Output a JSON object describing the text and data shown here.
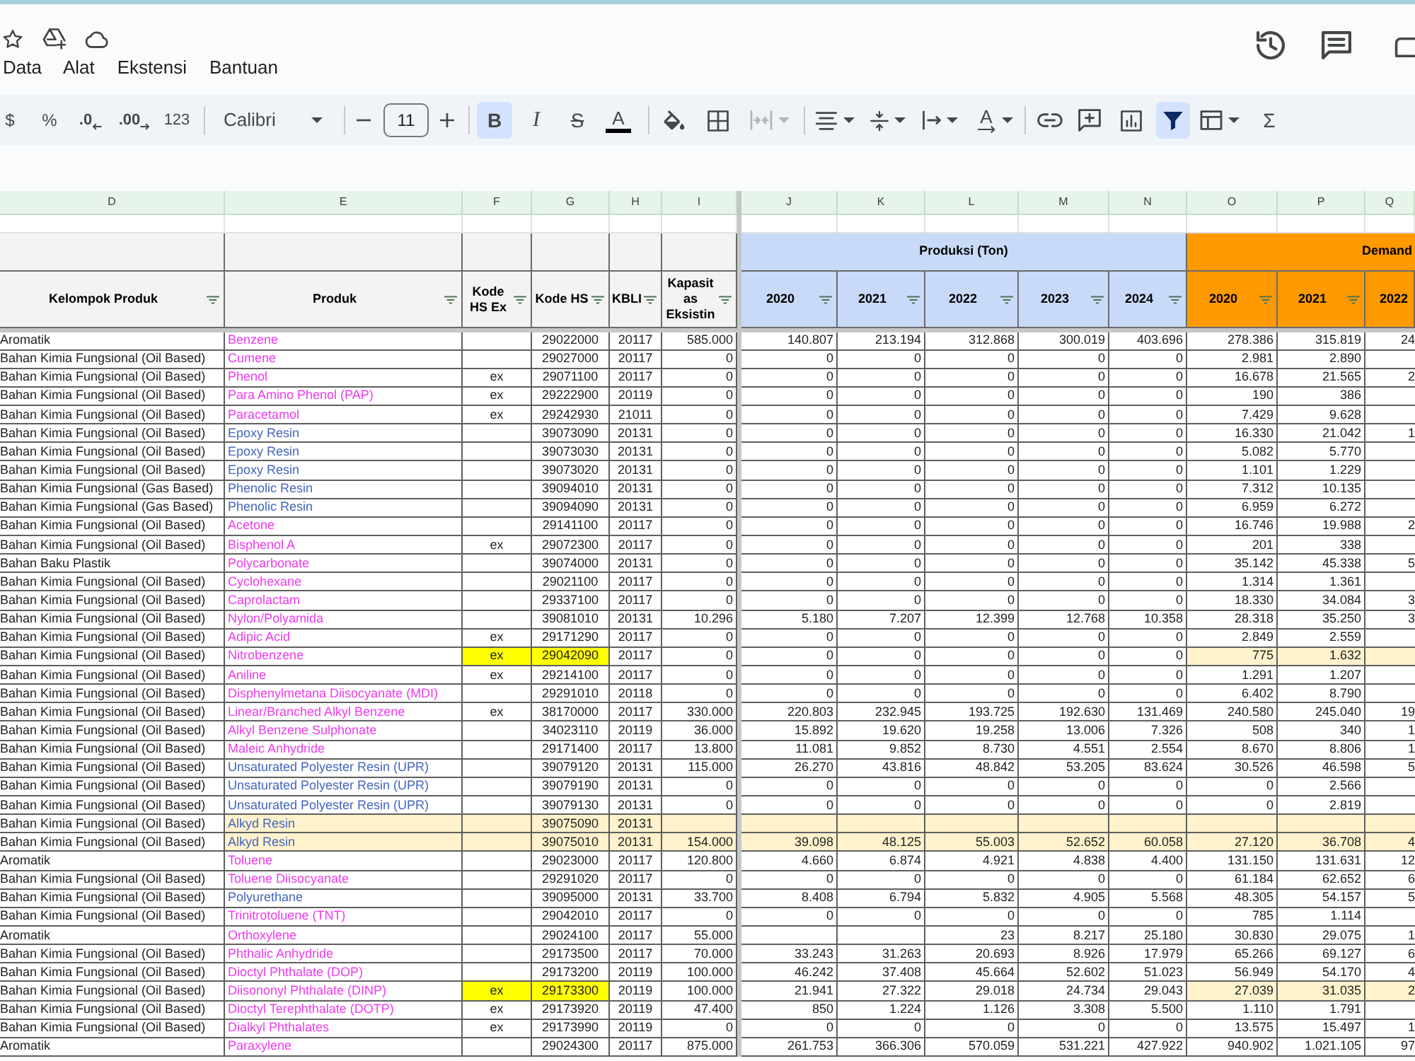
{
  "header": {
    "menu": [
      "Data",
      "Alat",
      "Ekstensi",
      "Bantuan"
    ]
  },
  "toolbar": {
    "formats": [
      "$",
      "%",
      ".0",
      ".00",
      "123"
    ],
    "font": "Calibri",
    "font_size": "11",
    "styles": [
      {
        "kind": "bold",
        "label": "B",
        "on": true
      },
      {
        "kind": "italic",
        "label": "I",
        "on": false
      },
      {
        "kind": "strike",
        "label": "S",
        "on": false
      },
      {
        "kind": "color",
        "label": "A",
        "on": false
      }
    ],
    "merge_disabled": true,
    "rotation_label": "A",
    "filter_on": true,
    "sum_label": "Σ"
  },
  "sheet": {
    "column_letters": [
      "D",
      "E",
      "F",
      "G",
      "H",
      "I",
      "J",
      "K",
      "L",
      "M",
      "N",
      "O",
      "P",
      "Q"
    ],
    "groups": [
      {
        "kind": "production",
        "label": "Produksi (Ton)"
      },
      {
        "kind": "demand",
        "label": "Demand"
      }
    ],
    "headers": [
      "Kelompok Produk",
      "Produk",
      "Kode HS Ex",
      "Kode HS",
      "KBLI",
      "Kapasitas Eksistin"
    ],
    "production_years": [
      "2020",
      "2021",
      "2022",
      "2023",
      "2024"
    ],
    "demand_years": [
      "2020",
      "2021",
      "2022"
    ],
    "rows": [
      {
        "group": "Aromatik",
        "product": "Benzene",
        "color": "#ee3bee",
        "hs": "29022000",
        "kbli": "20117",
        "capacity": "585.000",
        "prod_2020": "140.807",
        "prod_2021": "213.194",
        "prod_2022": "312.868",
        "prod_2023": "300.019",
        "prod_2024": "403.696",
        "demand_2020": "278.386",
        "demand_2021": "315.819",
        "demand_2022": "24",
        "hs_marked": false,
        "row_marked": false,
        "demand_marked": false
      },
      {
        "group": "Bahan Kimia Fungsional (Oil Based)",
        "product": "Cumene",
        "color": "#ee3bee",
        "hs": "29027000",
        "kbli": "20117",
        "capacity": "0",
        "prod_2020": "0",
        "prod_2021": "0",
        "prod_2022": "0",
        "prod_2023": "0",
        "prod_2024": "0",
        "demand_2020": "2.981",
        "demand_2021": "2.890",
        "hs_marked": false,
        "row_marked": false,
        "demand_marked": false
      },
      {
        "group": "Bahan Kimia Fungsional (Oil Based)",
        "product": "Phenol",
        "color": "#ee3bee",
        "hs_ex": "ex",
        "hs": "29071100",
        "kbli": "20117",
        "capacity": "0",
        "prod_2020": "0",
        "prod_2021": "0",
        "prod_2022": "0",
        "prod_2023": "0",
        "prod_2024": "0",
        "demand_2020": "16.678",
        "demand_2021": "21.565",
        "demand_2022": "2",
        "hs_marked": false,
        "row_marked": false,
        "demand_marked": false
      },
      {
        "group": "Bahan Kimia Fungsional (Oil Based)",
        "product": "Para Amino Phenol (PAP)",
        "color": "#ee3bee",
        "hs_ex": "ex",
        "hs": "29222900",
        "kbli": "20119",
        "capacity": "0",
        "prod_2020": "0",
        "prod_2021": "0",
        "prod_2022": "0",
        "prod_2023": "0",
        "prod_2024": "0",
        "demand_2020": "190",
        "demand_2021": "386",
        "hs_marked": false,
        "row_marked": false,
        "demand_marked": false
      },
      {
        "group": "Bahan Kimia Fungsional (Oil Based)",
        "product": "Paracetamol",
        "color": "#ee3bee",
        "hs_ex": "ex",
        "hs": "29242930",
        "kbli": "21011",
        "capacity": "0",
        "prod_2020": "0",
        "prod_2021": "0",
        "prod_2022": "0",
        "prod_2023": "0",
        "prod_2024": "0",
        "demand_2020": "7.429",
        "demand_2021": "9.628",
        "hs_marked": false,
        "row_marked": false,
        "demand_marked": false
      },
      {
        "group": "Bahan Kimia Fungsional (Oil Based)",
        "product": "Epoxy Resin",
        "color": "#4365bd",
        "hs": "39073090",
        "kbli": "20131",
        "capacity": "0",
        "prod_2020": "0",
        "prod_2021": "0",
        "prod_2022": "0",
        "prod_2023": "0",
        "prod_2024": "0",
        "demand_2020": "16.330",
        "demand_2021": "21.042",
        "demand_2022": "1",
        "hs_marked": false,
        "row_marked": false,
        "demand_marked": false
      },
      {
        "group": "Bahan Kimia Fungsional (Oil Based)",
        "product": "Epoxy Resin",
        "color": "#4365bd",
        "hs": "39073030",
        "kbli": "20131",
        "capacity": "0",
        "prod_2020": "0",
        "prod_2021": "0",
        "prod_2022": "0",
        "prod_2023": "0",
        "prod_2024": "0",
        "demand_2020": "5.082",
        "demand_2021": "5.770",
        "hs_marked": false,
        "row_marked": false,
        "demand_marked": false
      },
      {
        "group": "Bahan Kimia Fungsional (Oil Based)",
        "product": "Epoxy Resin",
        "color": "#4365bd",
        "hs": "39073020",
        "kbli": "20131",
        "capacity": "0",
        "prod_2020": "0",
        "prod_2021": "0",
        "prod_2022": "0",
        "prod_2023": "0",
        "prod_2024": "0",
        "demand_2020": "1.101",
        "demand_2021": "1.229",
        "hs_marked": false,
        "row_marked": false,
        "demand_marked": false
      },
      {
        "group": "Bahan Kimia Fungsional (Gas Based)",
        "product": "Phenolic Resin",
        "color": "#4365bd",
        "hs": "39094010",
        "kbli": "20131",
        "capacity": "0",
        "prod_2020": "0",
        "prod_2021": "0",
        "prod_2022": "0",
        "prod_2023": "0",
        "prod_2024": "0",
        "demand_2020": "7.312",
        "demand_2021": "10.135",
        "hs_marked": false,
        "row_marked": false,
        "demand_marked": false
      },
      {
        "group": "Bahan Kimia Fungsional (Gas Based)",
        "product": "Phenolic Resin",
        "color": "#4365bd",
        "hs": "39094090",
        "kbli": "20131",
        "capacity": "0",
        "prod_2020": "0",
        "prod_2021": "0",
        "prod_2022": "0",
        "prod_2023": "0",
        "prod_2024": "0",
        "demand_2020": "6.959",
        "demand_2021": "6.272",
        "hs_marked": false,
        "row_marked": false,
        "demand_marked": false
      },
      {
        "group": "Bahan Kimia Fungsional (Oil Based)",
        "product": "Acetone",
        "color": "#ee3bee",
        "hs": "29141100",
        "kbli": "20117",
        "capacity": "0",
        "prod_2020": "0",
        "prod_2021": "0",
        "prod_2022": "0",
        "prod_2023": "0",
        "prod_2024": "0",
        "demand_2020": "16.746",
        "demand_2021": "19.988",
        "demand_2022": "2",
        "hs_marked": false,
        "row_marked": false,
        "demand_marked": false
      },
      {
        "group": "Bahan Kimia Fungsional (Oil Based)",
        "product": "Bisphenol A",
        "color": "#ee3bee",
        "hs_ex": "ex",
        "hs": "29072300",
        "kbli": "20117",
        "capacity": "0",
        "prod_2020": "0",
        "prod_2021": "0",
        "prod_2022": "0",
        "prod_2023": "0",
        "prod_2024": "0",
        "demand_2020": "201",
        "demand_2021": "338",
        "hs_marked": false,
        "row_marked": false,
        "demand_marked": false
      },
      {
        "group": "Bahan Baku Plastik",
        "product": "Polycarbonate",
        "color": "#ee3bee",
        "hs": "39074000",
        "kbli": "20131",
        "capacity": "0",
        "prod_2020": "0",
        "prod_2021": "0",
        "prod_2022": "0",
        "prod_2023": "0",
        "prod_2024": "0",
        "demand_2020": "35.142",
        "demand_2021": "45.338",
        "demand_2022": "5",
        "hs_marked": false,
        "row_marked": false,
        "demand_marked": false
      },
      {
        "group": "Bahan Kimia Fungsional (Oil Based)",
        "product": "Cyclohexane",
        "color": "#ee3bee",
        "hs": "29021100",
        "kbli": "20117",
        "capacity": "0",
        "prod_2020": "0",
        "prod_2021": "0",
        "prod_2022": "0",
        "prod_2023": "0",
        "prod_2024": "0",
        "demand_2020": "1.314",
        "demand_2021": "1.361",
        "hs_marked": false,
        "row_marked": false,
        "demand_marked": false
      },
      {
        "group": "Bahan Kimia Fungsional (Oil Based)",
        "product": "Caprolactam",
        "color": "#ee3bee",
        "hs": "29337100",
        "kbli": "20117",
        "capacity": "0",
        "prod_2020": "0",
        "prod_2021": "0",
        "prod_2022": "0",
        "prod_2023": "0",
        "prod_2024": "0",
        "demand_2020": "18.330",
        "demand_2021": "34.084",
        "demand_2022": "3",
        "hs_marked": false,
        "row_marked": false,
        "demand_marked": false
      },
      {
        "group": "Bahan Kimia Fungsional (Oil Based)",
        "product": "Nylon/Polyamida",
        "color": "#ee3bee",
        "hs": "39081010",
        "kbli": "20131",
        "capacity": "10.296",
        "prod_2020": "5.180",
        "prod_2021": "7.207",
        "prod_2022": "12.399",
        "prod_2023": "12.768",
        "prod_2024": "10.358",
        "demand_2020": "28.318",
        "demand_2021": "35.250",
        "demand_2022": "3",
        "hs_marked": false,
        "row_marked": false,
        "demand_marked": false
      },
      {
        "group": "Bahan Kimia Fungsional (Oil Based)",
        "product": "Adipic Acid",
        "color": "#ee3bee",
        "hs_ex": "ex",
        "hs": "29171290",
        "kbli": "20117",
        "capacity": "0",
        "prod_2020": "0",
        "prod_2021": "0",
        "prod_2022": "0",
        "prod_2023": "0",
        "prod_2024": "0",
        "demand_2020": "2.849",
        "demand_2021": "2.559",
        "hs_marked": false,
        "row_marked": false,
        "demand_marked": false
      },
      {
        "group": "Bahan Kimia Fungsional (Oil Based)",
        "product": "Nitrobenzene",
        "color": "#ee3bee",
        "hs_ex": "ex",
        "hs": "29042090",
        "kbli": "20117",
        "capacity": "0",
        "prod_2020": "0",
        "prod_2021": "0",
        "prod_2022": "0",
        "prod_2023": "0",
        "prod_2024": "0",
        "demand_2020": "775",
        "demand_2021": "1.632",
        "hs_marked": true,
        "row_marked": false,
        "demand_marked": true
      },
      {
        "group": "Bahan Kimia Fungsional (Oil Based)",
        "product": "Aniline",
        "color": "#ee3bee",
        "hs_ex": "ex",
        "hs": "29214100",
        "kbli": "20117",
        "capacity": "0",
        "prod_2020": "0",
        "prod_2021": "0",
        "prod_2022": "0",
        "prod_2023": "0",
        "prod_2024": "0",
        "demand_2020": "1.291",
        "demand_2021": "1.207",
        "hs_marked": false,
        "row_marked": false,
        "demand_marked": false
      },
      {
        "group": "Bahan Kimia Fungsional (Oil Based)",
        "product": "Disphenylmetana Diisocyanate (MDI)",
        "color": "#ee3bee",
        "hs": "29291010",
        "kbli": "20118",
        "capacity": "0",
        "prod_2020": "0",
        "prod_2021": "0",
        "prod_2022": "0",
        "prod_2023": "0",
        "prod_2024": "0",
        "demand_2020": "6.402",
        "demand_2021": "8.790",
        "hs_marked": false,
        "row_marked": false,
        "demand_marked": false
      },
      {
        "group": "Bahan Kimia Fungsional (Oil Based)",
        "product": "Linear/Branched Alkyl Benzene",
        "color": "#ee3bee",
        "hs_ex": "ex",
        "hs": "38170000",
        "kbli": "20117",
        "capacity": "330.000",
        "prod_2020": "220.803",
        "prod_2021": "232.945",
        "prod_2022": "193.725",
        "prod_2023": "192.630",
        "prod_2024": "131.469",
        "demand_2020": "240.580",
        "demand_2021": "245.040",
        "demand_2022": "19",
        "hs_marked": false,
        "row_marked": false,
        "demand_marked": false
      },
      {
        "group": "Bahan Kimia Fungsional (Oil Based)",
        "product": "Alkyl Benzene Sulphonate",
        "color": "#ee3bee",
        "hs": "34023110",
        "kbli": "20119",
        "capacity": "36.000",
        "prod_2020": "15.892",
        "prod_2021": "19.620",
        "prod_2022": "19.258",
        "prod_2023": "13.006",
        "prod_2024": "7.326",
        "demand_2020": "508",
        "demand_2021": "340",
        "demand_2022": "1",
        "hs_marked": false,
        "row_marked": false,
        "demand_marked": false
      },
      {
        "group": "Bahan Kimia Fungsional (Oil Based)",
        "product": "Maleic Anhydride",
        "color": "#ee3bee",
        "hs": "29171400",
        "kbli": "20117",
        "capacity": "13.800",
        "prod_2020": "11.081",
        "prod_2021": "9.852",
        "prod_2022": "8.730",
        "prod_2023": "4.551",
        "prod_2024": "2.554",
        "demand_2020": "8.670",
        "demand_2021": "8.806",
        "demand_2022": "1",
        "hs_marked": false,
        "row_marked": false,
        "demand_marked": false
      },
      {
        "group": "Bahan Kimia Fungsional (Oil Based)",
        "product": "Unsaturated Polyester Resin (UPR)",
        "color": "#4365bd",
        "hs": "39079120",
        "kbli": "20131",
        "capacity": "115.000",
        "prod_2020": "26.270",
        "prod_2021": "43.816",
        "prod_2022": "48.842",
        "prod_2023": "53.205",
        "prod_2024": "83.624",
        "demand_2020": "30.526",
        "demand_2021": "46.598",
        "demand_2022": "5",
        "hs_marked": false,
        "row_marked": false,
        "demand_marked": false
      },
      {
        "group": "Bahan Kimia Fungsional (Oil Based)",
        "product": "Unsaturated Polyester Resin (UPR)",
        "color": "#4365bd",
        "hs": "39079190",
        "kbli": "20131",
        "capacity": "0",
        "prod_2020": "0",
        "prod_2021": "0",
        "prod_2022": "0",
        "prod_2023": "0",
        "prod_2024": "0",
        "demand_2020": "0",
        "demand_2021": "2.566",
        "hs_marked": false,
        "row_marked": false,
        "demand_marked": false
      },
      {
        "group": "Bahan Kimia Fungsional (Oil Based)",
        "product": "Unsaturated Polyester Resin (UPR)",
        "color": "#4365bd",
        "hs": "39079130",
        "kbli": "20131",
        "capacity": "0",
        "prod_2020": "0",
        "prod_2021": "0",
        "prod_2022": "0",
        "prod_2023": "0",
        "prod_2024": "0",
        "demand_2020": "0",
        "demand_2021": "2.819",
        "hs_marked": false,
        "row_marked": false,
        "demand_marked": false
      },
      {
        "group": "Bahan Kimia Fungsional (Oil Based)",
        "product": "Alkyd Resin",
        "color": "#4365bd",
        "hs": "39075090",
        "kbli": "20131",
        "hs_marked": false,
        "row_marked": true,
        "demand_marked": true
      },
      {
        "group": "Bahan Kimia Fungsional (Oil Based)",
        "product": "Alkyd Resin",
        "color": "#4365bd",
        "hs": "39075010",
        "kbli": "20131",
        "capacity": "154.000",
        "prod_2020": "39.098",
        "prod_2021": "48.125",
        "prod_2022": "55.003",
        "prod_2023": "52.652",
        "prod_2024": "60.058",
        "demand_2020": "27.120",
        "demand_2021": "36.708",
        "demand_2022": "4",
        "hs_marked": false,
        "row_marked": true,
        "demand_marked": true
      },
      {
        "group": "Aromatik",
        "product": "Toluene",
        "color": "#ee3bee",
        "hs": "29023000",
        "kbli": "20117",
        "capacity": "120.800",
        "prod_2020": "4.660",
        "prod_2021": "6.874",
        "prod_2022": "4.921",
        "prod_2023": "4.838",
        "prod_2024": "4.400",
        "demand_2020": "131.150",
        "demand_2021": "131.631",
        "demand_2022": "12",
        "hs_marked": false,
        "row_marked": false,
        "demand_marked": false
      },
      {
        "group": "Bahan Kimia Fungsional (Oil Based)",
        "product": "Toluene Diisocyanate",
        "color": "#ee3bee",
        "hs": "29291020",
        "kbli": "20117",
        "capacity": "0",
        "prod_2020": "0",
        "prod_2021": "0",
        "prod_2022": "0",
        "prod_2023": "0",
        "prod_2024": "0",
        "demand_2020": "61.184",
        "demand_2021": "62.652",
        "demand_2022": "6",
        "hs_marked": false,
        "row_marked": false,
        "demand_marked": false
      },
      {
        "group": "Bahan Kimia Fungsional (Oil Based)",
        "product": "Polyurethane",
        "color": "#4365bd",
        "hs": "39095000",
        "kbli": "20131",
        "capacity": "33.700",
        "prod_2020": "8.408",
        "prod_2021": "6.794",
        "prod_2022": "5.832",
        "prod_2023": "4.905",
        "prod_2024": "5.568",
        "demand_2020": "48.305",
        "demand_2021": "54.157",
        "demand_2022": "5",
        "hs_marked": false,
        "row_marked": false,
        "demand_marked": false
      },
      {
        "group": "Bahan Kimia Fungsional (Oil Based)",
        "product": "Trinitrotoluene (TNT)",
        "color": "#ee3bee",
        "hs": "29042010",
        "kbli": "20117",
        "capacity": "0",
        "prod_2020": "0",
        "prod_2021": "0",
        "prod_2022": "0",
        "prod_2023": "0",
        "prod_2024": "0",
        "demand_2020": "785",
        "demand_2021": "1.114",
        "hs_marked": false,
        "row_marked": false,
        "demand_marked": false
      },
      {
        "group": "Aromatik",
        "product": "Orthoxylene",
        "color": "#ee3bee",
        "hs": "29024100",
        "kbli": "20117",
        "capacity": "55.000",
        "prod_2022": "23",
        "prod_2023": "8.217",
        "prod_2024": "25.180",
        "demand_2020": "30.830",
        "demand_2021": "29.075",
        "demand_2022": "1",
        "hs_marked": false,
        "row_marked": false,
        "demand_marked": false
      },
      {
        "group": "Bahan Kimia Fungsional (Oil Based)",
        "product": "Phthalic Anhydride",
        "color": "#ee3bee",
        "hs": "29173500",
        "kbli": "20117",
        "capacity": "70.000",
        "prod_2020": "33.243",
        "prod_2021": "31.263",
        "prod_2022": "20.693",
        "prod_2023": "8.926",
        "prod_2024": "17.979",
        "demand_2020": "65.266",
        "demand_2021": "69.127",
        "demand_2022": "6",
        "hs_marked": false,
        "row_marked": false,
        "demand_marked": false
      },
      {
        "group": "Bahan Kimia Fungsional (Oil Based)",
        "product": "Dioctyl Phthalate (DOP)",
        "color": "#ee3bee",
        "hs": "29173200",
        "kbli": "20119",
        "capacity": "100.000",
        "prod_2020": "46.242",
        "prod_2021": "37.408",
        "prod_2022": "45.664",
        "prod_2023": "52.602",
        "prod_2024": "51.023",
        "demand_2020": "56.949",
        "demand_2021": "54.170",
        "demand_2022": "4",
        "hs_marked": false,
        "row_marked": false,
        "demand_marked": false
      },
      {
        "group": "Bahan Kimia Fungsional (Oil Based)",
        "product": "Diisononyl Phthalate (DINP)",
        "color": "#ee3bee",
        "hs_ex": "ex",
        "hs": "29173300",
        "kbli": "20119",
        "capacity": "100.000",
        "prod_2020": "21.941",
        "prod_2021": "27.322",
        "prod_2022": "29.018",
        "prod_2023": "24.734",
        "prod_2024": "29.043",
        "demand_2020": "27.039",
        "demand_2021": "31.035",
        "demand_2022": "2",
        "hs_marked": true,
        "row_marked": false,
        "demand_marked": true
      },
      {
        "group": "Bahan Kimia Fungsional (Oil Based)",
        "product": "Dioctyl Terephthalate (DOTP)",
        "color": "#ee3bee",
        "hs_ex": "ex",
        "hs": "29173920",
        "kbli": "20119",
        "capacity": "47.400",
        "prod_2020": "850",
        "prod_2021": "1.224",
        "prod_2022": "1.126",
        "prod_2023": "3.308",
        "prod_2024": "5.500",
        "demand_2020": "1.110",
        "demand_2021": "1.791",
        "hs_marked": false,
        "row_marked": false,
        "demand_marked": false
      },
      {
        "group": "Bahan Kimia Fungsional (Oil Based)",
        "product": "Dialkyl Phthalates",
        "color": "#ee3bee",
        "hs_ex": "ex",
        "hs": "29173990",
        "kbli": "20119",
        "capacity": "0",
        "prod_2020": "0",
        "prod_2021": "0",
        "prod_2022": "0",
        "prod_2023": "0",
        "prod_2024": "0",
        "demand_2020": "13.575",
        "demand_2021": "15.497",
        "demand_2022": "1",
        "hs_marked": false,
        "row_marked": false,
        "demand_marked": false
      },
      {
        "group": "Aromatik",
        "product": "Paraxylene",
        "color": "#ee3bee",
        "hs": "29024300",
        "kbli": "20117",
        "capacity": "875.000",
        "prod_2020": "261.753",
        "prod_2021": "366.306",
        "prod_2022": "570.059",
        "prod_2023": "531.221",
        "prod_2024": "427.922",
        "demand_2020": "940.902",
        "demand_2021": "1.021.105",
        "demand_2022": "97",
        "hs_marked": false,
        "row_marked": false,
        "demand_marked": false
      }
    ]
  }
}
